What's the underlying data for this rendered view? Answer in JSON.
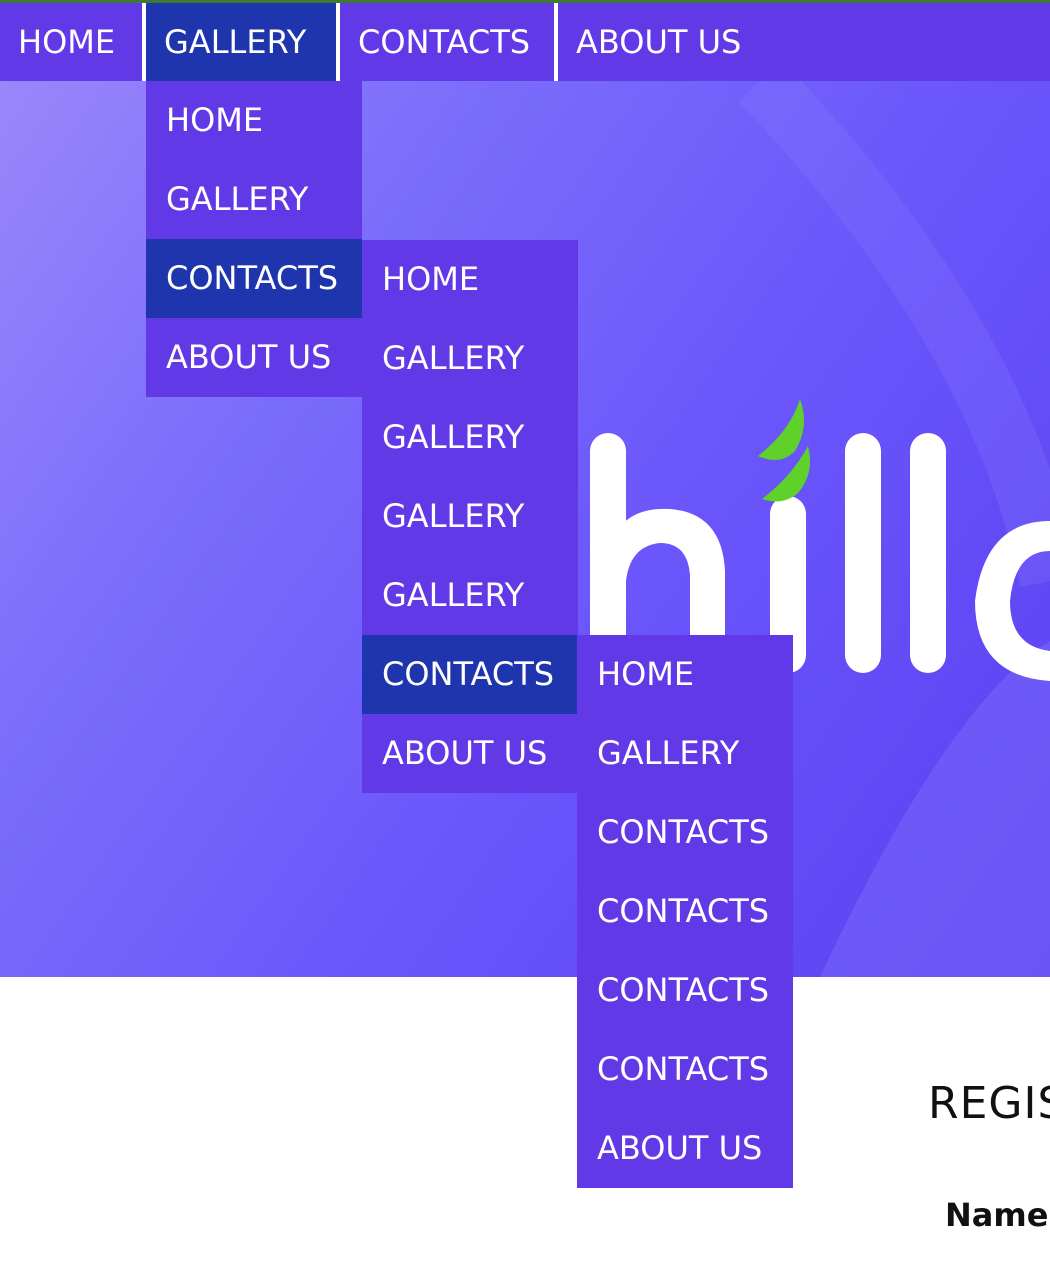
{
  "nav": {
    "items": [
      {
        "label": "HOME"
      },
      {
        "label": "GALLERY"
      },
      {
        "label": "CONTACTS"
      },
      {
        "label": "ABOUT US"
      }
    ]
  },
  "dropdown1": {
    "items": [
      {
        "label": "HOME"
      },
      {
        "label": "GALLERY"
      },
      {
        "label": "CONTACTS"
      },
      {
        "label": "ABOUT US"
      }
    ]
  },
  "dropdown2": {
    "items": [
      {
        "label": "HOME"
      },
      {
        "label": "GALLERY"
      },
      {
        "label": "GALLERY"
      },
      {
        "label": "GALLERY"
      },
      {
        "label": "GALLERY"
      },
      {
        "label": "CONTACTS"
      },
      {
        "label": "ABOUT US"
      }
    ]
  },
  "dropdown3": {
    "items": [
      {
        "label": "HOME"
      },
      {
        "label": "GALLERY"
      },
      {
        "label": "CONTACTS"
      },
      {
        "label": "CONTACTS"
      },
      {
        "label": "CONTACTS"
      },
      {
        "label": "CONTACTS"
      },
      {
        "label": "ABOUT US"
      }
    ]
  },
  "hero": {
    "logo_text": "hille",
    "logo_icon": "leaf-icon"
  },
  "registration": {
    "title": "REGIS",
    "name_label": "Name"
  },
  "colors": {
    "nav_bg": "#6139e6",
    "active_bg": "#1f35ad",
    "hero_gradient_start": "#9a86fb",
    "hero_gradient_end": "#5a40f0",
    "logo_leaf": "#5fd12a",
    "top_strip": "#3d7a2f"
  }
}
